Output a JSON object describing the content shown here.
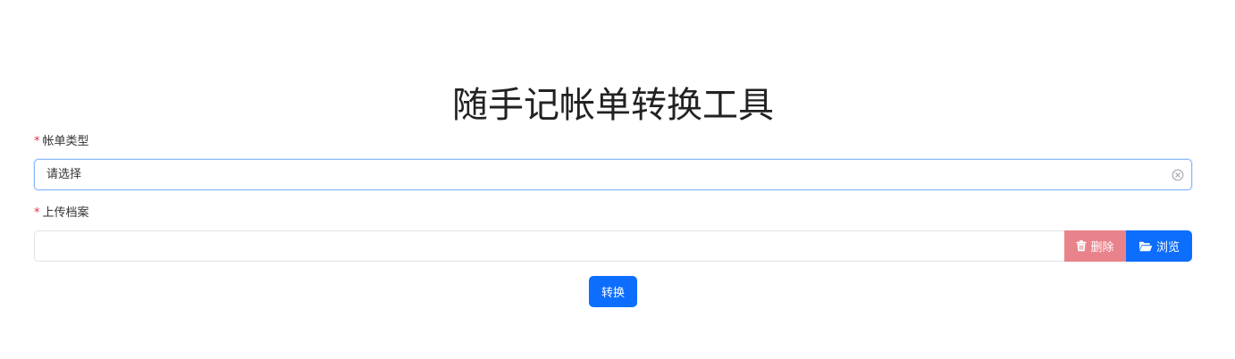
{
  "page": {
    "title": "随手记帐单转换工具"
  },
  "form": {
    "bill_type": {
      "required_mark": "*",
      "label": "帐单类型",
      "value": "请选择"
    },
    "upload": {
      "required_mark": "*",
      "label": "上传档案",
      "value": "",
      "delete_label": "删除",
      "browse_label": "浏览"
    },
    "convert_label": "转换"
  },
  "icons": {
    "clear": "circle-x-icon",
    "delete": "trash-icon",
    "browse": "folder-open-icon"
  },
  "colors": {
    "primary": "#0d6efd",
    "danger_light": "#e8838b",
    "required": "#dc3545",
    "focus_border": "#86b7fe"
  }
}
